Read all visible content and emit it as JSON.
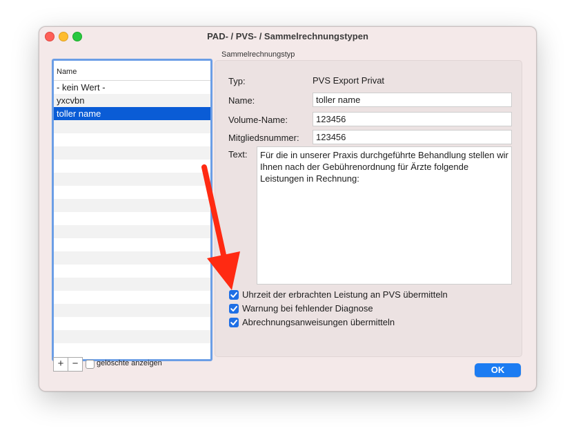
{
  "window": {
    "title": "PAD- / PVS- / Sammelrechnungstypen"
  },
  "list": {
    "header": "Name",
    "items": [
      {
        "label": "- kein Wert -",
        "selected": false
      },
      {
        "label": "yxcvbn",
        "selected": false
      },
      {
        "label": "toller name",
        "selected": true
      }
    ]
  },
  "bottom": {
    "add_label": "+",
    "remove_label": "−",
    "show_deleted_label": "gelöschte anzeigen",
    "show_deleted_checked": false
  },
  "group": {
    "title": "Sammelrechnungstyp",
    "typ_label": "Typ:",
    "typ_value": "PVS Export Privat",
    "name_label": "Name:",
    "name_value": "toller name",
    "volume_label": "Volume-Name:",
    "volume_value": "123456",
    "mitglied_label": "Mitgliedsnummer:",
    "mitglied_value": "123456",
    "text_label": "Text:",
    "text_value": "Für die in unserer Praxis durchgeführte Behandlung stellen wir Ihnen nach der Gebührenordnung für Ärzte folgende Leistungen in Rechnung:"
  },
  "options": [
    {
      "label": "Uhrzeit der erbrachten Leistung an PVS übermitteln",
      "checked": true
    },
    {
      "label": "Warnung bei fehlender Diagnose",
      "checked": true
    },
    {
      "label": "Abrechnungsanweisungen übermitteln",
      "checked": true
    }
  ],
  "ok_label": "OK",
  "colors": {
    "accent": "#1c7cf2",
    "selection": "#0a5cd6",
    "annotation_arrow": "#ff2a12"
  }
}
